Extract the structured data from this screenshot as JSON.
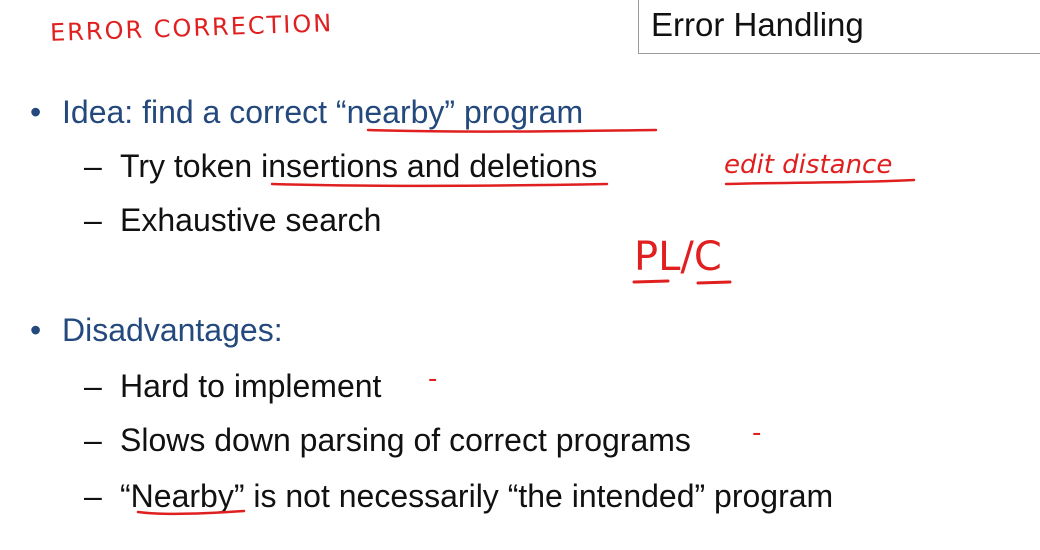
{
  "slide": {
    "title": "Error Handling",
    "bullets": [
      {
        "text": "Idea: find a correct “nearby” program",
        "subs": [
          "Try token insertions and deletions",
          "Exhaustive search"
        ]
      },
      {
        "text": "Disadvantages:",
        "subs": [
          "Hard to implement",
          "Slows down parsing of correct programs",
          "“Nearby” is not necessarily “the intended” program"
        ]
      }
    ],
    "dash": "–",
    "bullet_glyph": "•"
  },
  "annotations": {
    "heading": "ERROR CORRECTION",
    "edit_distance": "edit distance",
    "pl_c": "PL/C",
    "mark": "-"
  },
  "colors": {
    "bullet_text": "#24497d",
    "sub_text": "#111111",
    "ink": "#e02020",
    "title_border": "#9a9a9a"
  }
}
